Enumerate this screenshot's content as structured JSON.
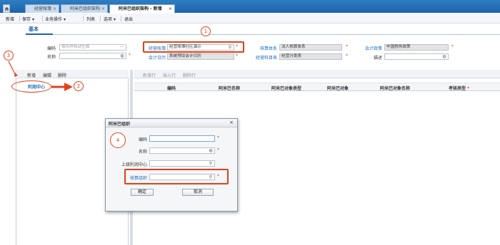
{
  "tabs": [
    {
      "label": "经营账簿",
      "active": false
    },
    {
      "label": "阿米巴组织架构",
      "active": false
    },
    {
      "label": "阿米巴组织架构 - 新增",
      "active": true
    }
  ],
  "menu": [
    "新增",
    "保存",
    "业务操作",
    "列表",
    "选项",
    "退出"
  ],
  "section_tab": "基本",
  "form": {
    "code_label": "编码",
    "code_placeholder": "保存时自动生成",
    "name_label": "名称",
    "ledger_label": "经营账簿",
    "ledger_value": "经营账簿社区演示",
    "calendar_label": "会计日历",
    "calendar_value": "系统预设会计日历",
    "system_label": "核算体系",
    "system_value": "法人核算体系",
    "chart_label": "经营科目表",
    "chart_value": "经营分类表",
    "policy_label": "会计政策",
    "policy_value": "中国税务政策",
    "desc_label": "描述"
  },
  "left_toolbar": [
    "新增",
    "编辑",
    "删除"
  ],
  "tree_root": "利润中心",
  "right_toolbar": [
    "新增行",
    "插入行",
    "删除行"
  ],
  "grid_columns": [
    "编码",
    "阿米巴名称",
    "阿米巴对象类型",
    "阿米巴对象",
    "阿米巴对象名称",
    "考核类型"
  ],
  "dialog": {
    "title": "阿米巴组织",
    "code_label": "编码",
    "name_label": "名称",
    "parent_label": "上级利润中心",
    "org_label": "核算组织",
    "ok_label": "确定",
    "cancel_label": "取消"
  },
  "annotations": [
    "1",
    "2",
    "3",
    "4"
  ],
  "colors": {
    "accent": "#1d63a8",
    "highlight": "#e0421b",
    "link": "#1a6fc0"
  }
}
